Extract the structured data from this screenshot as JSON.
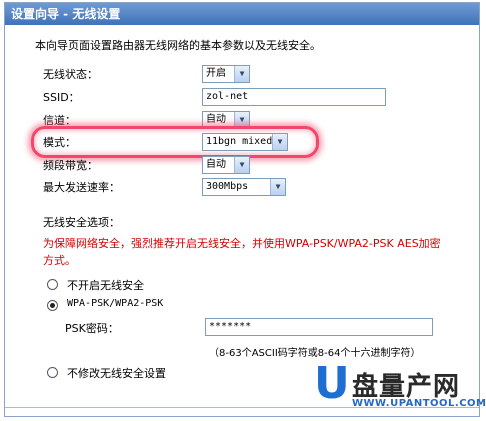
{
  "window": {
    "title": "设置向导 - 无线设置"
  },
  "intro": "本向导页面设置路由器无线网络的基本参数以及无线安全。",
  "fields": {
    "wireless_status": {
      "label": "无线状态：",
      "value": "开启"
    },
    "ssid": {
      "label": "SSID：",
      "value": "zol-net"
    },
    "channel": {
      "label": "信道：",
      "value": "自动"
    },
    "mode": {
      "label": "模式：",
      "value": "11bgn mixed"
    },
    "bandwidth": {
      "label": "频段带宽：",
      "value": "自动"
    },
    "max_rate": {
      "label": "最大发送速率：",
      "value": "300Mbps"
    }
  },
  "security": {
    "title": "无线安全选项：",
    "warning": "为保障网络安全，强烈推荐开启无线安全，并使用WPA-PSK/WPA2-PSK AES加密方式。",
    "options": {
      "disable": "不开启无线安全",
      "wpa": "WPA-PSK/WPA2-PSK",
      "keep": "不修改无线安全设置"
    },
    "psk_label": "PSK密码：",
    "psk_value": "*******",
    "psk_hint": "（8-63个ASCII码字符或8-64个十六进制字符）"
  },
  "watermark": {
    "brand": "U",
    "name": "盘量产网",
    "url": "WWW.UPANTOOL.COM"
  },
  "colors": {
    "titlebar": "#3f72b8",
    "warning": "#d40000",
    "highlight": "#f2466a",
    "brand": "#1f6fd2"
  }
}
